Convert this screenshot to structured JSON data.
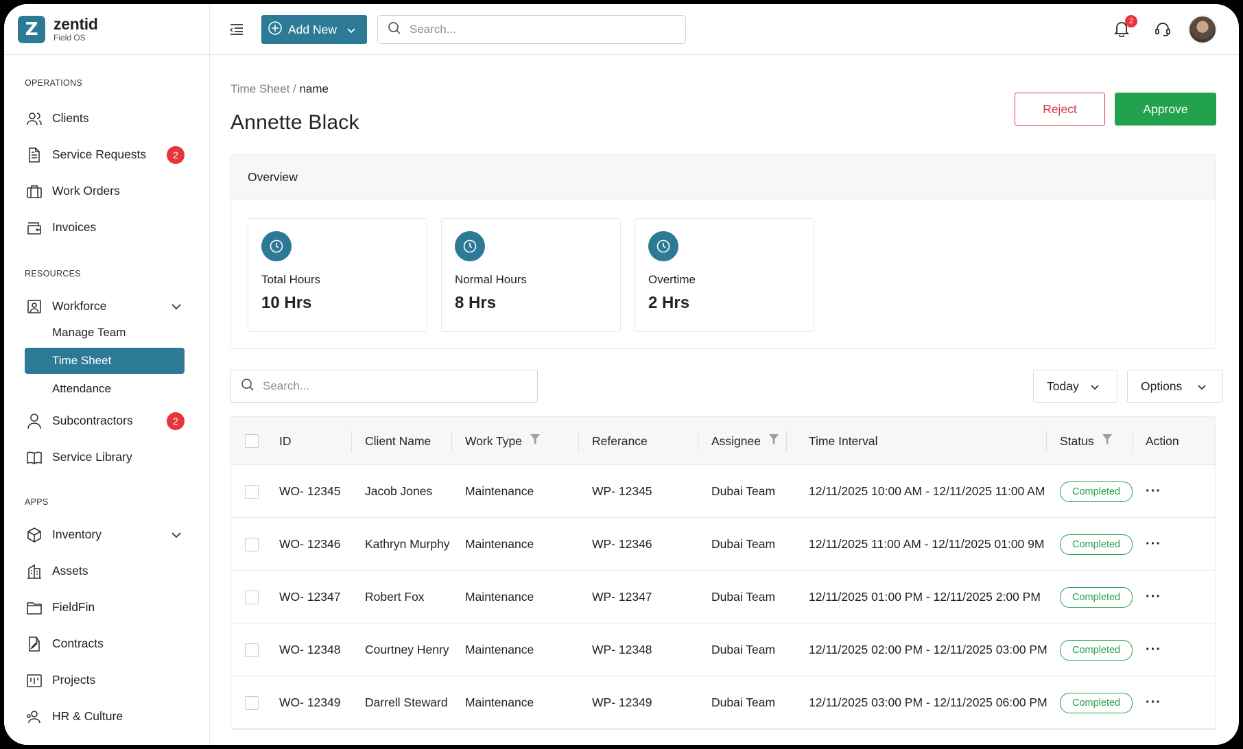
{
  "brand": {
    "logo_letter": "Z",
    "name": "zentid",
    "sub": "Field OS"
  },
  "sidebar": {
    "sections": {
      "operations": "OPERATIONS",
      "resources": "RESOURCES",
      "apps": "APPS"
    },
    "items": {
      "clients": "Clients",
      "service_requests": "Service Requests",
      "service_requests_badge": "2",
      "work_orders": "Work Orders",
      "invoices": "Invoices",
      "workforce": "Workforce",
      "manage_team": "Manage Team",
      "time_sheet": "Time Sheet",
      "attendance": "Attendance",
      "subcontractors": "Subcontractors",
      "subcontractors_badge": "2",
      "service_library": "Service Library",
      "inventory": "Inventory",
      "assets": "Assets",
      "fieldfin": "FieldFin",
      "contracts": "Contracts",
      "projects": "Projects",
      "hr_culture": "HR & Culture"
    }
  },
  "topbar": {
    "add_new": "Add New",
    "search_placeholder": "Search...",
    "notifications_count": "2"
  },
  "page": {
    "breadcrumb_root": "Time Sheet",
    "breadcrumb_sep": " / ",
    "breadcrumb_current": "name",
    "title": "Annette Black",
    "reject": "Reject",
    "approve": "Approve"
  },
  "overview": {
    "title": "Overview",
    "stats": [
      {
        "label": "Total Hours",
        "value": "10 Hrs"
      },
      {
        "label": "Normal Hours",
        "value": "8 Hrs"
      },
      {
        "label": "Overtime",
        "value": "2 Hrs"
      }
    ]
  },
  "table_controls": {
    "search_placeholder": "Search...",
    "range": "Today",
    "options": "Options"
  },
  "table": {
    "headers": {
      "id": "ID",
      "client": "Client Name",
      "work_type": "Work Type",
      "reference": "Referance",
      "assignee": "Assignee",
      "interval": "Time Interval",
      "status": "Status",
      "action": "Action"
    },
    "rows": [
      {
        "id": "WO- 12345",
        "client": "Jacob Jones",
        "work_type": "Maintenance",
        "reference": "WP- 12345",
        "assignee": "Dubai Team",
        "interval": "12/11/2025 10:00 AM - 12/11/2025 11:00 AM",
        "status": "Completed"
      },
      {
        "id": "WO- 12346",
        "client": "Kathryn Murphy",
        "work_type": "Maintenance",
        "reference": "WP- 12346",
        "assignee": "Dubai Team",
        "interval": "12/11/2025 11:00 AM - 12/11/2025 01:00 9M",
        "status": "Completed"
      },
      {
        "id": "WO- 12347",
        "client": "Robert Fox",
        "work_type": "Maintenance",
        "reference": "WP- 12347",
        "assignee": "Dubai Team",
        "interval": "12/11/2025 01:00 PM - 12/11/2025 2:00 PM",
        "status": "Completed"
      },
      {
        "id": "WO- 12348",
        "client": "Courtney Henry",
        "work_type": "Maintenance",
        "reference": "WP- 12348",
        "assignee": "Dubai Team",
        "interval": "12/11/2025 02:00 PM - 12/11/2025 03:00 PM",
        "status": "Completed"
      },
      {
        "id": "WO- 12349",
        "client": "Darrell Steward",
        "work_type": "Maintenance",
        "reference": "WP- 12349",
        "assignee": "Dubai Team",
        "interval": "12/11/2025 03:00 PM - 12/11/2025 06:00 PM",
        "status": "Completed"
      }
    ]
  },
  "colors": {
    "brand": "#2c7a95",
    "approve": "#22a24c",
    "reject": "#e0353b",
    "badge": "#e8343c"
  }
}
